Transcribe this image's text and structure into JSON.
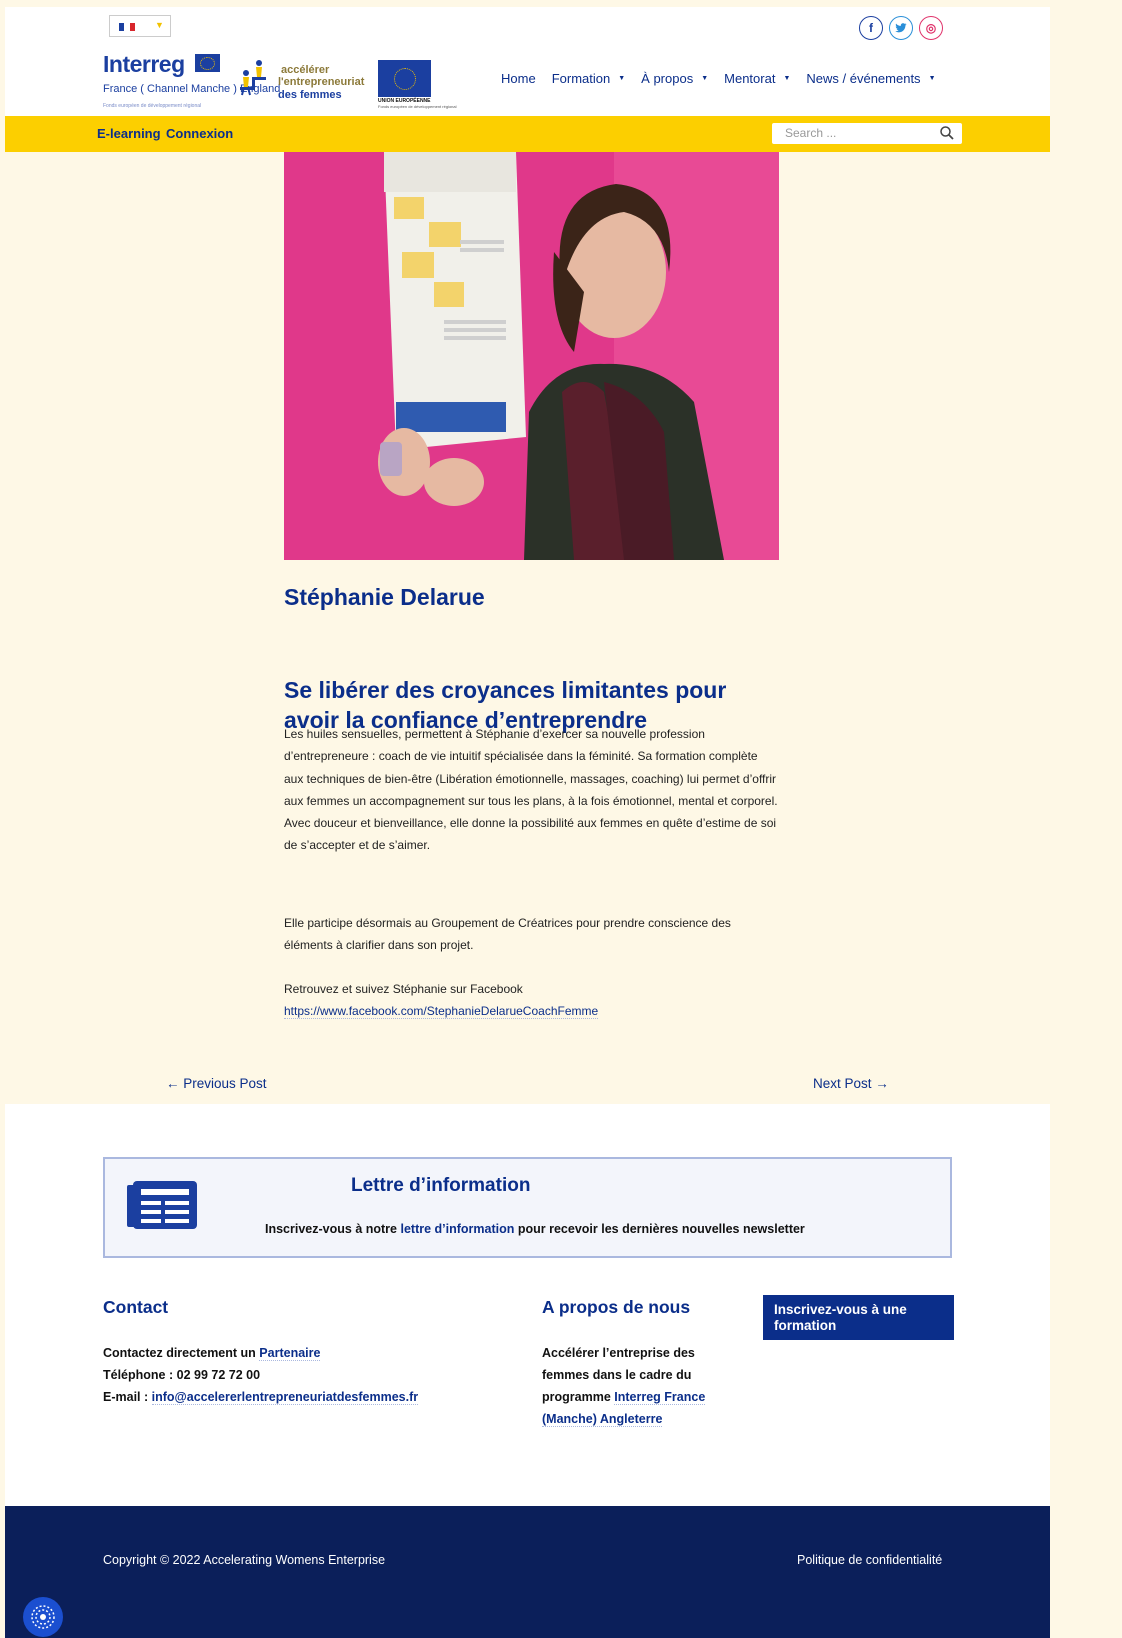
{
  "header": {
    "language": {
      "selected": "FR"
    },
    "social": {
      "facebook": "f",
      "twitter": "t",
      "instagram": "◎"
    },
    "logos": {
      "interreg": {
        "word": "Interreg",
        "sub": "France ( Channel Manche ) England",
        "tiny": "Fonds européen de développement régional"
      },
      "aef": {
        "line1": "accélérer",
        "line2": "l'entrepreneuriat",
        "line3": "des femmes"
      },
      "ue": {
        "line1": "UNION EUROPÉENNE",
        "line2": "Fonds européen de développement régional"
      }
    },
    "nav": [
      {
        "label": "Home",
        "dropdown": false
      },
      {
        "label": "Formation",
        "dropdown": true
      },
      {
        "label": "À propos",
        "dropdown": true
      },
      {
        "label": "Mentorat",
        "dropdown": true
      },
      {
        "label": "News / événements",
        "dropdown": true
      }
    ]
  },
  "topbar": {
    "elearning": "E-learning",
    "connexion": "Connexion",
    "search_placeholder": "Search ..."
  },
  "article": {
    "title": "Stéphanie Delarue",
    "subtitle": "Se libérer des croyances limitantes pour avoir la confiance d’entreprendre",
    "paragraph1": "Les huiles sensuelles, permettent à Stéphanie d’exercer sa nouvelle profession d’entrepreneure : coach de vie intuitif spécialisée dans la féminité. Sa formation complète aux techniques de bien-être (Libération émotionnelle, massages, coaching) lui permet d’offrir aux femmes un accompagnement sur tous les plans, à la fois émotionnel, mental et corporel. Avec douceur et bienveillance, elle donne la possibilité aux femmes en quête d’estime de soi de s’accepter et de s’aimer.",
    "paragraph2": "Elle participe désormais au Groupement de Créatrices pour prendre conscience des éléments à clarifier dans son projet.",
    "paragraph3": "Retrouvez et suivez Stéphanie sur Facebook",
    "facebook_link": "https://www.facebook.com/StephanieDelarueCoachFemme"
  },
  "post_nav": {
    "previous": "← Previous Post",
    "next": "Next Post →"
  },
  "newsletter": {
    "title": "Lettre d’information",
    "text_before": "Inscrivez-vous à notre",
    "link": "lettre d’information",
    "text_after": "pour recevoir les dernières nouvelles newsletter"
  },
  "contact": {
    "title": "Contact",
    "line1_prefix": "Contactez directement un",
    "line1_link": "Partenaire",
    "phone": "Téléphone : 02 99 72 72 00",
    "email_prefix": "E-mail :",
    "email_link": "info@accelererlentrepreneuriatdesfemmes.fr"
  },
  "about": {
    "title": "A propos de nous",
    "line1": "Accélérer l’entreprise des",
    "line2": "femmes dans le cadre du",
    "line3_prefix": "programme",
    "line3_link": "Interreg France",
    "line4_link": "(Manche) Angleterre"
  },
  "cta": {
    "label": "Inscrivez-vous à une formation"
  },
  "footer": {
    "copyright": "Copyright © 2022 Accelerating Womens Enterprise",
    "privacy": "Politique de confidentialité"
  },
  "colors": {
    "brand_blue": "#0b2e8a",
    "yellow": "#fccf00",
    "page_bg": "#fef8e6",
    "footer_dark": "#0b1f5a",
    "photo_pink": "#e23e8c"
  }
}
